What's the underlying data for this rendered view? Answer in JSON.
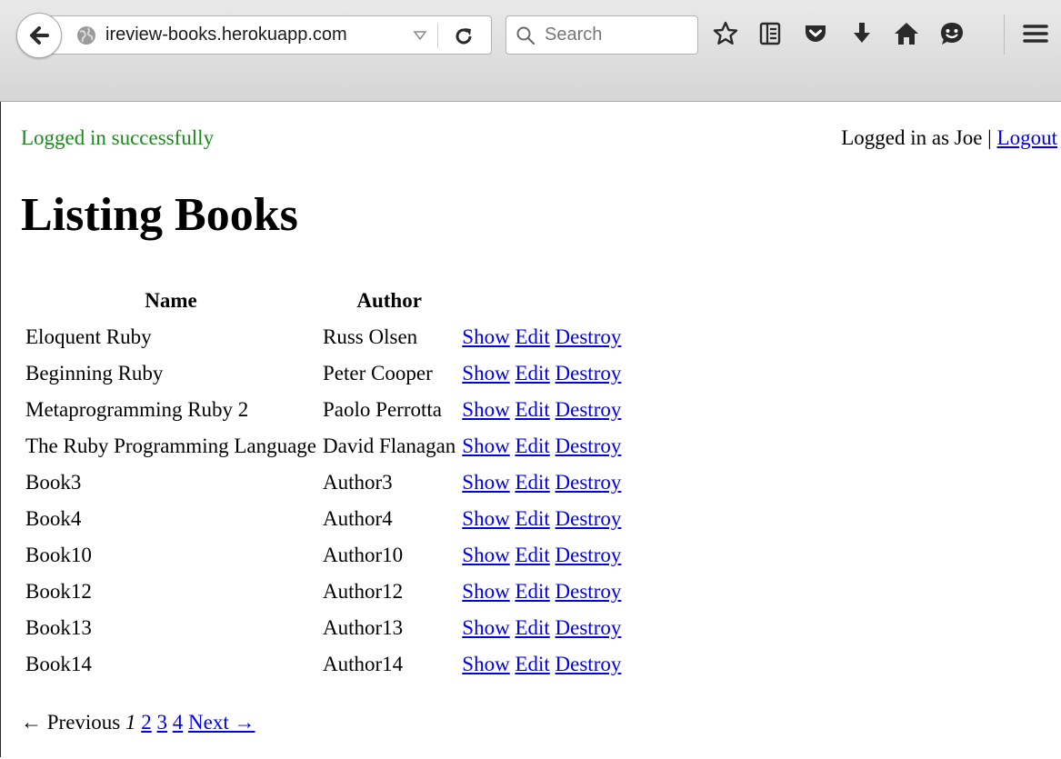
{
  "browser": {
    "url": "ireview-books.herokuapp.com",
    "search_placeholder": "Search"
  },
  "flash": {
    "notice": "Logged in successfully"
  },
  "user_status": {
    "prefix": "Logged in as Joe | ",
    "logout_label": "Logout"
  },
  "page": {
    "title": "Listing Books"
  },
  "table": {
    "columns": [
      "Name",
      "Author"
    ],
    "action_labels": {
      "show": "Show",
      "edit": "Edit",
      "destroy": "Destroy"
    },
    "rows": [
      {
        "name": "Eloquent Ruby",
        "author": "Russ Olsen"
      },
      {
        "name": "Beginning Ruby",
        "author": "Peter Cooper"
      },
      {
        "name": "Metaprogramming Ruby 2",
        "author": "Paolo Perrotta"
      },
      {
        "name": "The Ruby Programming Language",
        "author": "David Flanagan"
      },
      {
        "name": "Book3",
        "author": "Author3"
      },
      {
        "name": "Book4",
        "author": "Author4"
      },
      {
        "name": "Book10",
        "author": "Author10"
      },
      {
        "name": "Book12",
        "author": "Author12"
      },
      {
        "name": "Book13",
        "author": "Author13"
      },
      {
        "name": "Book14",
        "author": "Author14"
      }
    ]
  },
  "pagination": {
    "previous_label": "← Previous",
    "current_page": "1",
    "pages": [
      "2",
      "3",
      "4"
    ],
    "next_label": "Next →"
  },
  "icons": {
    "back": "back-arrow-icon",
    "site": "globe-icon",
    "dropmarker": "dropmarker-icon",
    "reload": "reload-icon",
    "search": "search-icon",
    "toolbar": [
      "bookmark-star-icon",
      "reading-list-icon",
      "pocket-icon",
      "download-icon",
      "home-icon",
      "chat-icon",
      "menu-icon"
    ]
  },
  "colors": {
    "link": "#0000ee",
    "notice": "#1a8a1a",
    "toolbar_icon": "#3a3a3a"
  }
}
